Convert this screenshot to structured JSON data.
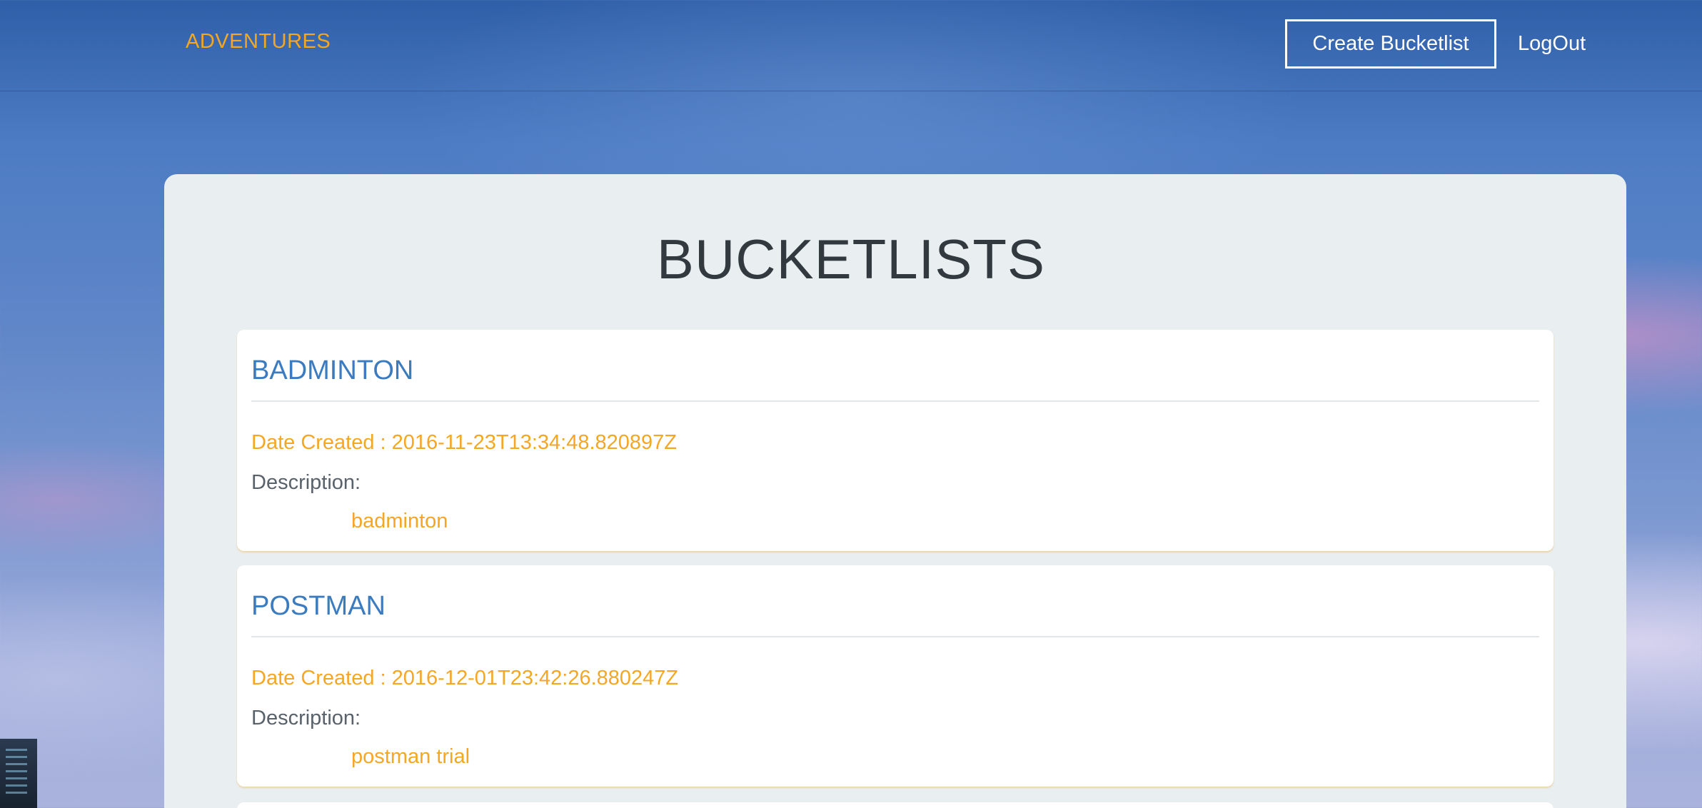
{
  "navbar": {
    "brand": "ADVENTURES",
    "create_label": "Create Bucketlist",
    "logout_label": "LogOut"
  },
  "main": {
    "title": "BUCKETLISTS",
    "bucketlists": [
      {
        "name": "BADMINTON",
        "date_created": "Date Created : 2016-11-23T13:34:48.820897Z",
        "description_label": "Description:",
        "description": "badminton"
      },
      {
        "name": "POSTMAN",
        "date_created": "Date Created : 2016-12-01T23:42:26.880247Z",
        "description_label": "Description:",
        "description": "postman trial"
      }
    ]
  },
  "colors": {
    "accent": "#f5a623",
    "title_blue": "#3b7bbf",
    "panel": "#e9eef1"
  }
}
